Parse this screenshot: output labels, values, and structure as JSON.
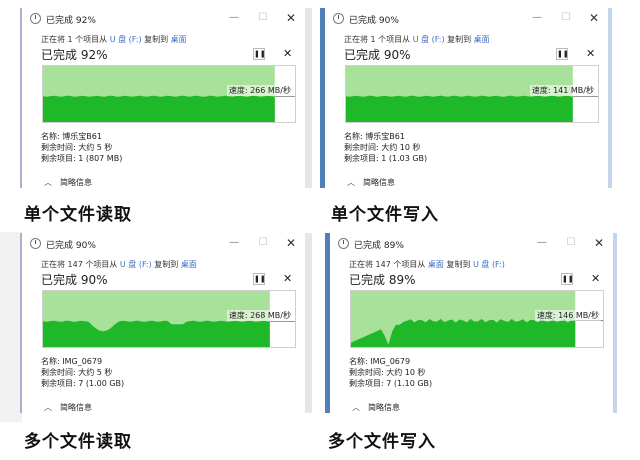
{
  "panels": [
    {
      "title": "已完成 92%",
      "copy_prefix": "正在将 1 个项目从 ",
      "source": "U 盘 (F:)",
      "copy_middle": " 复制到 ",
      "dest": "桌面",
      "percent_text": "已完成 92%",
      "progress": 0.92,
      "speed_text": "速度: 266 MB/秒",
      "speed_level": 0.46,
      "speed_profile": "flat",
      "name_line": "名称: 博乐宝B61",
      "time_line": "剩余时间: 大约 5 秒",
      "items_line": "剩余项目: 1 (807 MB)",
      "details_label": "简略信息",
      "caption": "单个文件读取"
    },
    {
      "title": "已完成 90%",
      "copy_prefix": "正在将 1 个项目从 ",
      "source": "U 盘 (F:)",
      "copy_middle": " 复制到 ",
      "dest": "桌面",
      "percent_text": "已完成 90%",
      "progress": 0.9,
      "speed_text": "速度: 141 MB/秒",
      "speed_level": 0.46,
      "speed_profile": "flat",
      "name_line": "名称: 博乐宝B61",
      "time_line": "剩余时间: 大约 10 秒",
      "items_line": "剩余项目: 1 (1.03 GB)",
      "details_label": "简略信息",
      "caption": "单个文件写入"
    },
    {
      "title": "已完成 90%",
      "copy_prefix": "正在将 147 个项目从 ",
      "source": "U 盘 (F:)",
      "copy_middle": " 复制到 ",
      "dest": "桌面",
      "percent_text": "已完成 90%",
      "progress": 0.9,
      "speed_text": "速度: 268 MB/秒",
      "speed_level": 0.46,
      "speed_profile": "dip",
      "name_line": "名称: IMG_0679",
      "time_line": "剩余时间: 大约 5 秒",
      "items_line": "剩余项目: 7 (1.00 GB)",
      "details_label": "简略信息",
      "caption": "多个文件读取"
    },
    {
      "title": "已完成 89%",
      "copy_prefix": "正在将 147 个项目从 ",
      "source": "桌面",
      "copy_middle": " 复制到 ",
      "dest": "U 盘 (F:)",
      "percent_text": "已完成 89%",
      "progress": 0.89,
      "speed_text": "速度: 146 MB/秒",
      "speed_level": 0.47,
      "speed_profile": "spiky",
      "name_line": "名称: IMG_0679",
      "time_line": "剩余时间: 大约 10 秒",
      "items_line": "剩余项目: 7 (1.10 GB)",
      "details_label": "简略信息",
      "caption": "多个文件写入"
    }
  ],
  "colors": {
    "graph_light": "#a8e29a",
    "graph_dark": "#1fb829",
    "link": "#3a6ec2"
  }
}
